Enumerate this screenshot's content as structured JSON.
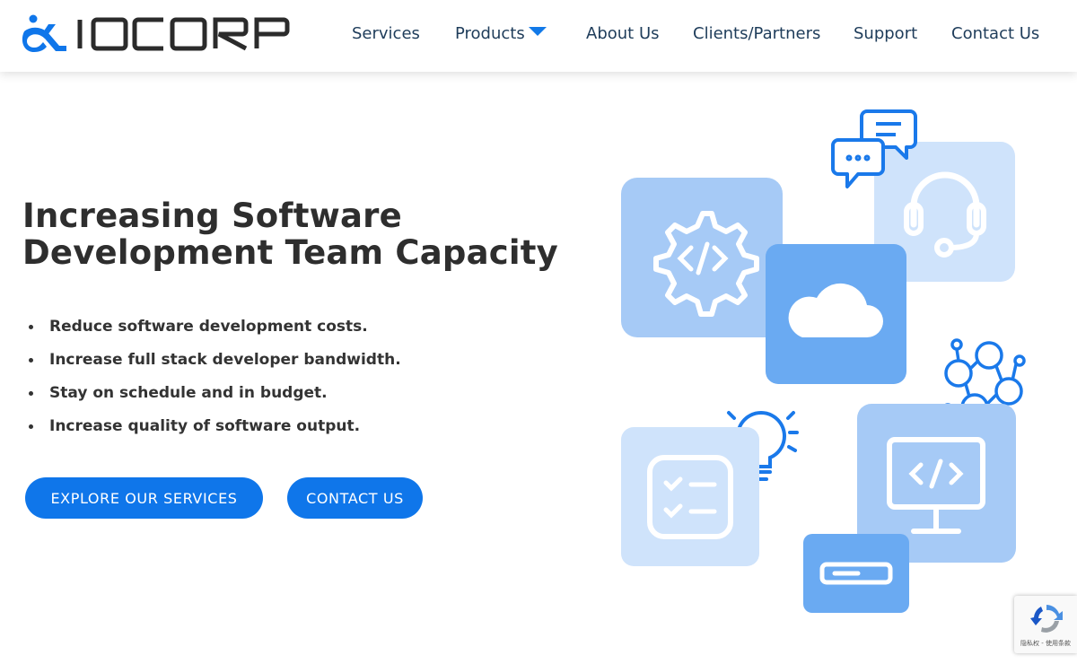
{
  "brand": {
    "name": "IOCORP",
    "accent": "#0f76ea",
    "logo_dark": "#2b2b2b"
  },
  "nav": {
    "items": [
      {
        "label": "Services"
      },
      {
        "label": "Products",
        "has_dropdown": true
      },
      {
        "label": "About Us"
      },
      {
        "label": "Clients/Partners"
      },
      {
        "label": "Support"
      },
      {
        "label": "Contact Us"
      }
    ]
  },
  "hero": {
    "title_line1": "Increasing Software",
    "title_line2": "Development Team Capacity",
    "bullets": [
      "Reduce software development costs.",
      "Increase full stack developer bandwidth.",
      "Stay on schedule and in budget.",
      "Increase quality of software output."
    ],
    "buttons": {
      "explore": "EXPLORE OUR SERVICES",
      "contact": "CONTACT US"
    }
  },
  "illustration": {
    "icons": [
      "code-gear-icon",
      "headset-icon",
      "chat-bubbles-icon",
      "cloud-icon",
      "network-people-icon",
      "lightbulb-icon",
      "checklist-icon",
      "code-monitor-icon",
      "server-icon"
    ],
    "colors": {
      "light": "#cfe3fb",
      "mid": "#a6caf6",
      "strong": "#6aaaf2"
    }
  },
  "recaptcha": {
    "text": "隐私权 - 使用条款",
    "icon": "recaptcha-icon"
  }
}
